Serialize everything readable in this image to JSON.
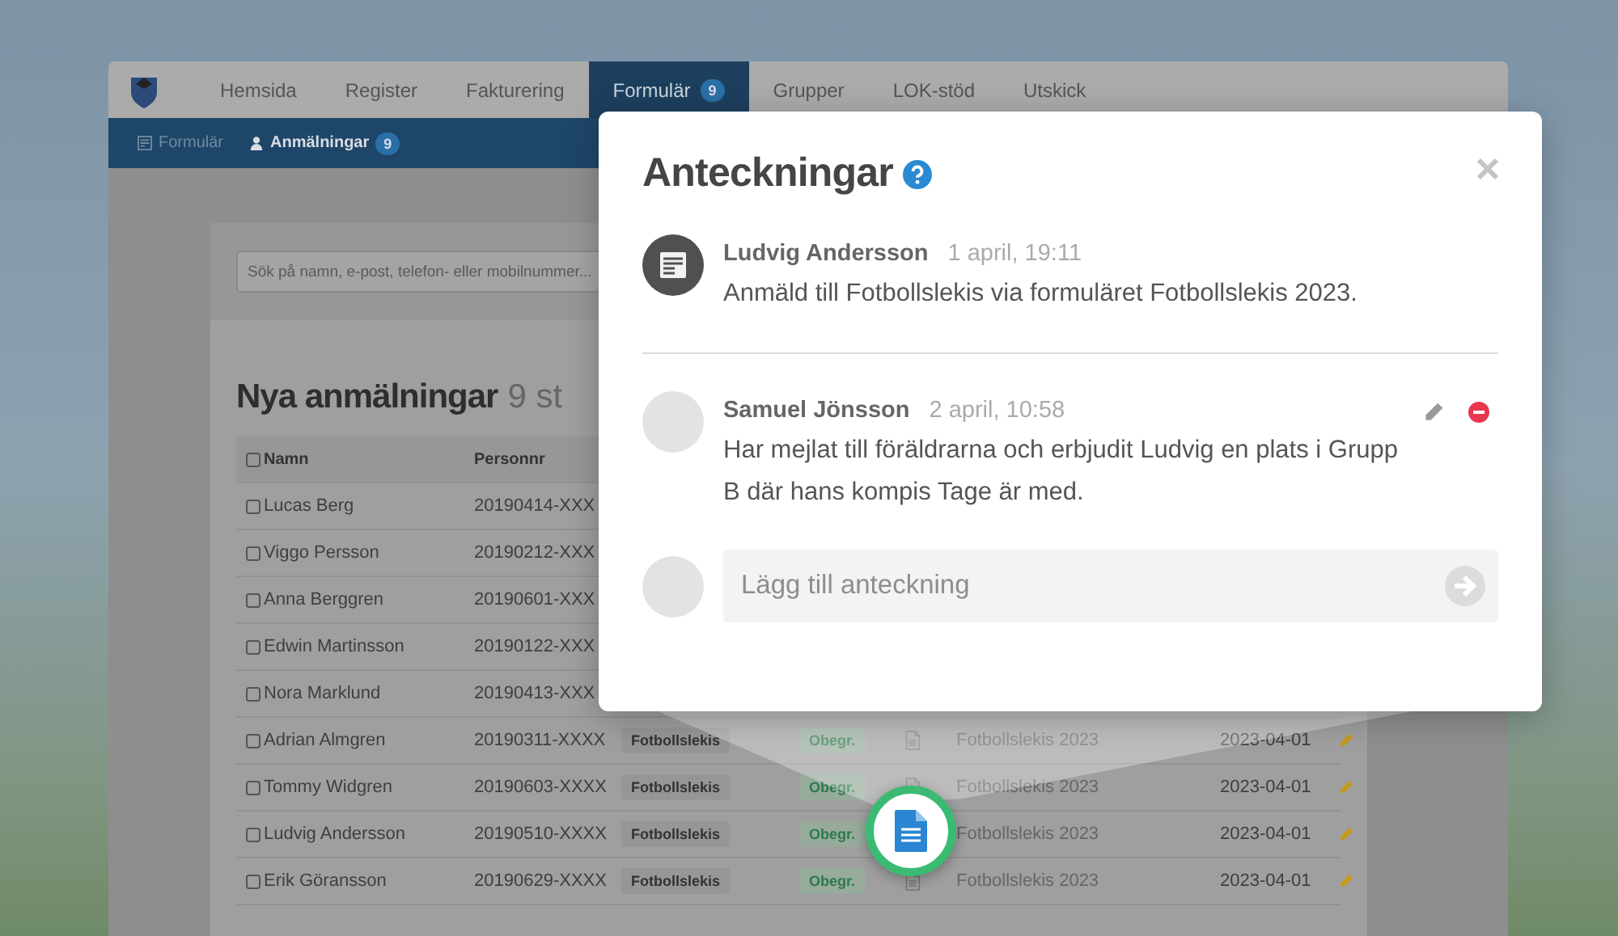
{
  "nav": {
    "tabs": [
      {
        "label": "Hemsida",
        "selected": false
      },
      {
        "label": "Register",
        "selected": false
      },
      {
        "label": "Fakturering",
        "selected": false
      },
      {
        "label": "Formulär",
        "badge": "9",
        "selected": true
      },
      {
        "label": "Grupper",
        "selected": false
      },
      {
        "label": "LOK-stöd",
        "selected": false
      },
      {
        "label": "Utskick",
        "selected": false
      }
    ]
  },
  "subnav": {
    "items": [
      {
        "label": "Formulär",
        "kind": "form",
        "selected": false
      },
      {
        "label": "Anmälningar",
        "kind": "user",
        "badge": "9",
        "selected": true
      }
    ]
  },
  "search": {
    "placeholder": "Sök på namn, e-post, telefon- eller mobilnummer..."
  },
  "list": {
    "title": "Nya anmälningar",
    "count": "9 st",
    "select_all_checked": false,
    "columns": [
      "Namn",
      "Personnr"
    ],
    "rows": [
      {
        "name": "Lucas Berg",
        "personnr": "20190414-XXX",
        "checked": false
      },
      {
        "name": "Viggo Persson",
        "personnr": "20190212-XXX",
        "checked": false
      },
      {
        "name": "Anna Berggren",
        "personnr": "20190601-XXX",
        "checked": false
      },
      {
        "name": "Edwin Martinsson",
        "personnr": "20190122-XXX",
        "checked": false
      },
      {
        "name": "Nora Marklund",
        "personnr": "20190413-XXX",
        "checked": false
      },
      {
        "name": "Adrian Almgren",
        "personnr": "20190311-XXXX",
        "checked": false,
        "group": "Fotbollslekis",
        "status": "Obegr.",
        "form": "Fotbollslekis 2023",
        "date": "2023-04-01"
      },
      {
        "name": "Tommy Widgren",
        "personnr": "20190603-XXXX",
        "checked": false,
        "group": "Fotbollslekis",
        "status": "Obegr.",
        "form": "Fotbollslekis 2023",
        "date": "2023-04-01"
      },
      {
        "name": "Ludvig Andersson",
        "personnr": "20190510-XXXX",
        "checked": false,
        "group": "Fotbollslekis",
        "status": "Obegr.",
        "form": "Fotbollslekis 2023",
        "date": "2023-04-01"
      },
      {
        "name": "Erik Göransson",
        "personnr": "20190629-XXXX",
        "checked": false,
        "group": "Fotbollslekis",
        "status": "Obegr.",
        "form": "Fotbollslekis 2023",
        "date": "2023-04-01"
      }
    ]
  },
  "notes_dialog": {
    "title": "Anteckningar",
    "notes": [
      {
        "kind": "system",
        "author": "Ludvig Andersson",
        "time": "1 april, 19:11",
        "text": "Anmäld till Fotbollslekis via formuläret Fotbollslekis 2023."
      },
      {
        "kind": "user",
        "author": "Samuel Jönsson",
        "time": "2 april, 10:58",
        "text": "Har mejlat till föräldrarna och erbjudit Ludvig en plats i Grupp B där hans kompis Tage är med."
      }
    ],
    "input": {
      "placeholder": "Lägg till anteckning"
    }
  }
}
